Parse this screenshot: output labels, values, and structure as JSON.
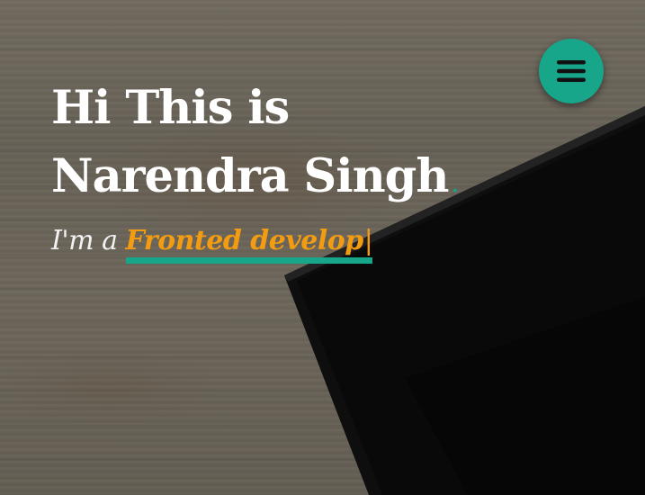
{
  "hero": {
    "title": "Hi This is Narendra Singh",
    "title_dot": ".",
    "tagline_prefix": "I'm a ",
    "typed_text": "Fronted develop",
    "cursor": "|"
  },
  "menu_button": {
    "icon": "hamburger-menu-icon"
  },
  "colors": {
    "accent": "#17a68a",
    "typed_text": "#f39c12",
    "title": "#ffffff"
  }
}
